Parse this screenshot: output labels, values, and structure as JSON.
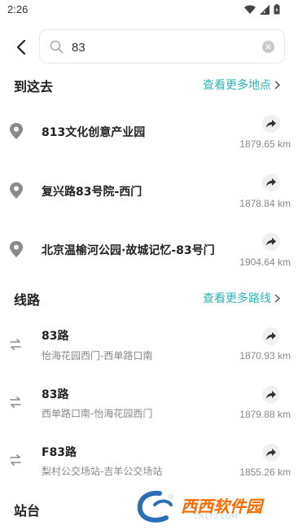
{
  "status": {
    "time": "2:26"
  },
  "search": {
    "value": "83"
  },
  "places": {
    "title": "到这去",
    "more": "查看更多地点",
    "items": [
      {
        "title": "813文化创意产业园",
        "distance": "1879.65 km"
      },
      {
        "title": "复兴路83号院-西门",
        "distance": "1878.84 km"
      },
      {
        "title": "北京温榆河公园·故城记忆-83号门",
        "distance": "1904.64 km"
      }
    ]
  },
  "routes": {
    "title": "线路",
    "more": "查看更多路线",
    "items": [
      {
        "title": "83路",
        "sub": "怡海花园西门-西单路口南",
        "distance": "1870.93 km"
      },
      {
        "title": "83路",
        "sub": "西单路口南-怡海花园西门",
        "distance": "1879.88 km"
      },
      {
        "title": "F83路",
        "sub": "梨村公交场站-吉羊公交场站",
        "distance": "1855.26 km"
      }
    ]
  },
  "stations": {
    "title": "站台"
  },
  "watermark": {
    "text": "西西软件园",
    "sub": "CR173.COM"
  },
  "icons": {
    "back": "chevron-left-icon",
    "search": "search-icon",
    "clear": "clear-icon",
    "place": "location-pin-icon",
    "route": "route-swap-icon",
    "share": "share-arrow-icon"
  },
  "colors": {
    "accent": "#2fb3b3"
  }
}
